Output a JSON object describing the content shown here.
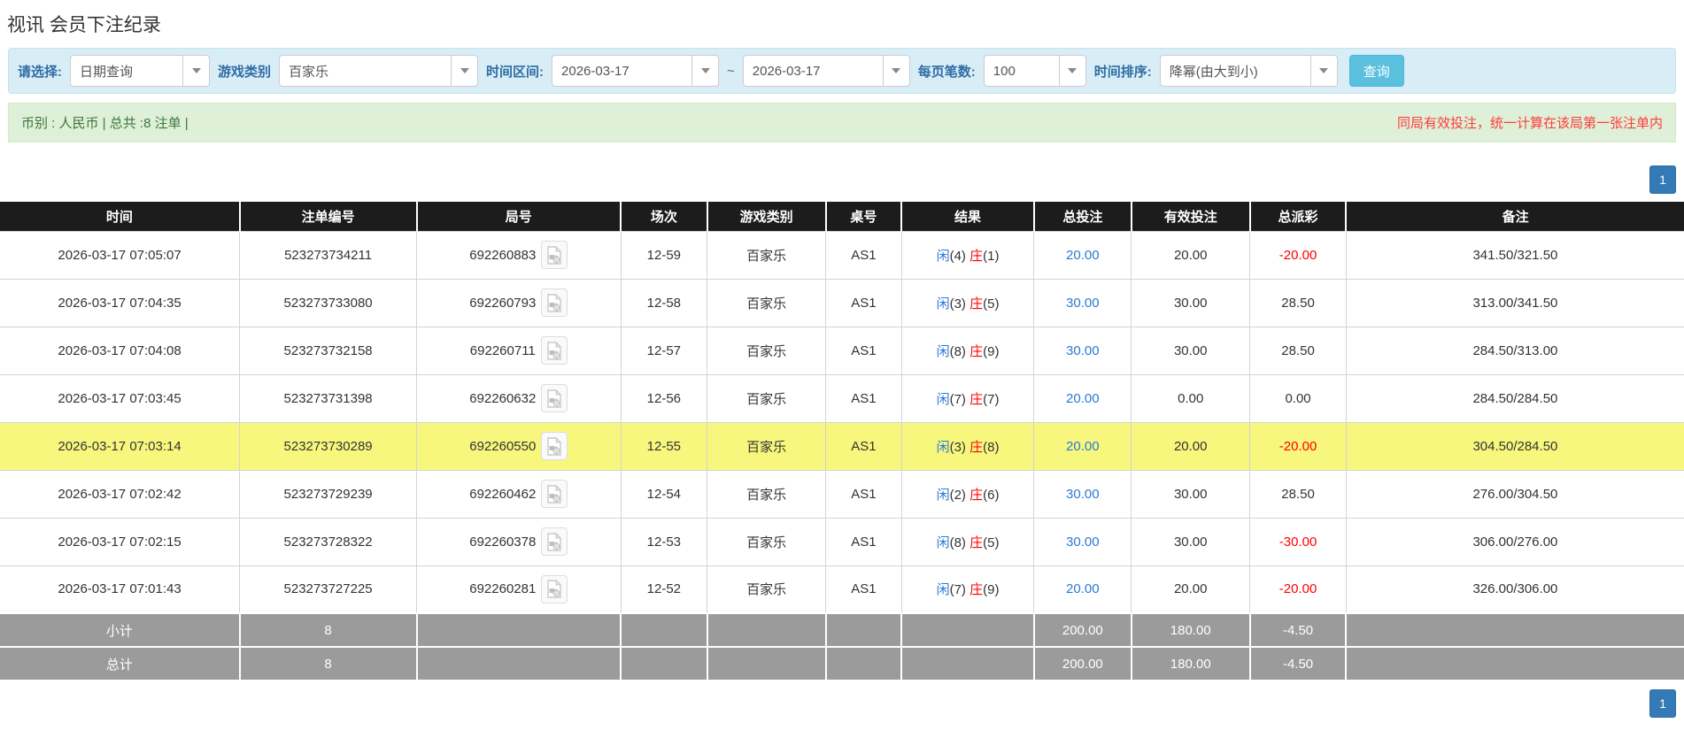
{
  "page_title": "视讯 会员下注纪录",
  "filters": {
    "select_label": "请选择:",
    "query_type": "日期查询",
    "game_category_label": "游戏类别",
    "game_category": "百家乐",
    "time_range_label": "时间区间:",
    "date_from": "2026-03-17",
    "tilde": "~",
    "date_to": "2026-03-17",
    "page_size_label": "每页笔数:",
    "page_size": "100",
    "sort_label": "时间排序:",
    "sort_order": "降幂(由大到小)",
    "search_button": "查询"
  },
  "summary_bar": {
    "left_text": "币别 : 人民币 | 总共 :8 注单 |",
    "right_text": "同局有效投注，统一计算在该局第一张注单内"
  },
  "pagination": {
    "page": "1"
  },
  "colors": {
    "accent_blue": "#337ab7",
    "link_blue": "#2a7ad2",
    "negative_red": "#ff0000",
    "notice_red": "#ff3b3b",
    "header_black": "#1c1c1c",
    "highlight_yellow": "#f7f77d",
    "summary_gray": "#9b9b9b",
    "filter_bg": "#d9edf7",
    "notice_bg": "#dff0d8",
    "notice_green": "#3c763d",
    "search_btn_bg": "#5bc0de"
  },
  "table": {
    "headers": [
      "时间",
      "注单编号",
      "局号",
      "场次",
      "游戏类别",
      "桌号",
      "结果",
      "总投注",
      "有效投注",
      "总派彩",
      "备注"
    ],
    "col_widths": [
      "14.23%",
      "10.51%",
      "12.12%",
      "5.13%",
      "7.05%",
      "4.49%",
      "7.88%",
      "5.77%",
      "7.05%",
      "5.71%",
      "20.06%"
    ],
    "video_icon": "video-file-icon",
    "rows": [
      {
        "time": "2026-03-17 07:05:07",
        "bet_id": "523273734211",
        "round_id": "692260883",
        "session": "12-59",
        "game": "百家乐",
        "table_no": "AS1",
        "result_p_label": "闲",
        "result_p_num": "(4)",
        "result_b_label": "庄",
        "result_b_num": "(1)",
        "total_bet": "20.00",
        "valid_bet": "20.00",
        "payout": "-20.00",
        "remark": "341.50/321.50",
        "highlight": false
      },
      {
        "time": "2026-03-17 07:04:35",
        "bet_id": "523273733080",
        "round_id": "692260793",
        "session": "12-58",
        "game": "百家乐",
        "table_no": "AS1",
        "result_p_label": "闲",
        "result_p_num": "(3)",
        "result_b_label": "庄",
        "result_b_num": "(5)",
        "total_bet": "30.00",
        "valid_bet": "30.00",
        "payout": "28.50",
        "remark": "313.00/341.50",
        "highlight": false
      },
      {
        "time": "2026-03-17 07:04:08",
        "bet_id": "523273732158",
        "round_id": "692260711",
        "session": "12-57",
        "game": "百家乐",
        "table_no": "AS1",
        "result_p_label": "闲",
        "result_p_num": "(8)",
        "result_b_label": "庄",
        "result_b_num": "(9)",
        "total_bet": "30.00",
        "valid_bet": "30.00",
        "payout": "28.50",
        "remark": "284.50/313.00",
        "highlight": false
      },
      {
        "time": "2026-03-17 07:03:45",
        "bet_id": "523273731398",
        "round_id": "692260632",
        "session": "12-56",
        "game": "百家乐",
        "table_no": "AS1",
        "result_p_label": "闲",
        "result_p_num": "(7)",
        "result_b_label": "庄",
        "result_b_num": "(7)",
        "total_bet": "20.00",
        "valid_bet": "0.00",
        "payout": "0.00",
        "remark": "284.50/284.50",
        "highlight": false
      },
      {
        "time": "2026-03-17 07:03:14",
        "bet_id": "523273730289",
        "round_id": "692260550",
        "session": "12-55",
        "game": "百家乐",
        "table_no": "AS1",
        "result_p_label": "闲",
        "result_p_num": "(3)",
        "result_b_label": "庄",
        "result_b_num": "(8)",
        "total_bet": "20.00",
        "valid_bet": "20.00",
        "payout": "-20.00",
        "remark": "304.50/284.50",
        "highlight": true
      },
      {
        "time": "2026-03-17 07:02:42",
        "bet_id": "523273729239",
        "round_id": "692260462",
        "session": "12-54",
        "game": "百家乐",
        "table_no": "AS1",
        "result_p_label": "闲",
        "result_p_num": "(2)",
        "result_b_label": "庄",
        "result_b_num": "(6)",
        "total_bet": "30.00",
        "valid_bet": "30.00",
        "payout": "28.50",
        "remark": "276.00/304.50",
        "highlight": false
      },
      {
        "time": "2026-03-17 07:02:15",
        "bet_id": "523273728322",
        "round_id": "692260378",
        "session": "12-53",
        "game": "百家乐",
        "table_no": "AS1",
        "result_p_label": "闲",
        "result_p_num": "(8)",
        "result_b_label": "庄",
        "result_b_num": "(5)",
        "total_bet": "30.00",
        "valid_bet": "30.00",
        "payout": "-30.00",
        "remark": "306.00/276.00",
        "highlight": false
      },
      {
        "time": "2026-03-17 07:01:43",
        "bet_id": "523273727225",
        "round_id": "692260281",
        "session": "12-52",
        "game": "百家乐",
        "table_no": "AS1",
        "result_p_label": "闲",
        "result_p_num": "(7)",
        "result_b_label": "庄",
        "result_b_num": "(9)",
        "total_bet": "20.00",
        "valid_bet": "20.00",
        "payout": "-20.00",
        "remark": "326.00/306.00",
        "highlight": false
      }
    ],
    "summaries": [
      {
        "label": "小计",
        "count": "8",
        "total_bet": "200.00",
        "valid_bet": "180.00",
        "payout": "-4.50"
      },
      {
        "label": "总计",
        "count": "8",
        "total_bet": "200.00",
        "valid_bet": "180.00",
        "payout": "-4.50"
      }
    ]
  }
}
